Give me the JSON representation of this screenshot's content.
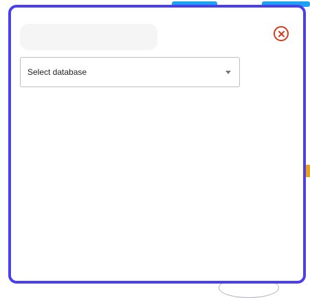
{
  "dialog": {
    "title": "",
    "close_icon": "close-circle-icon",
    "database_select": {
      "placeholder": "Select database",
      "selected": ""
    }
  },
  "colors": {
    "dialog_border": "#4b3df0",
    "close_icon": "#d13a1b",
    "title_placeholder_bg": "#f5f5f5",
    "select_border": "#bdbdbd"
  }
}
